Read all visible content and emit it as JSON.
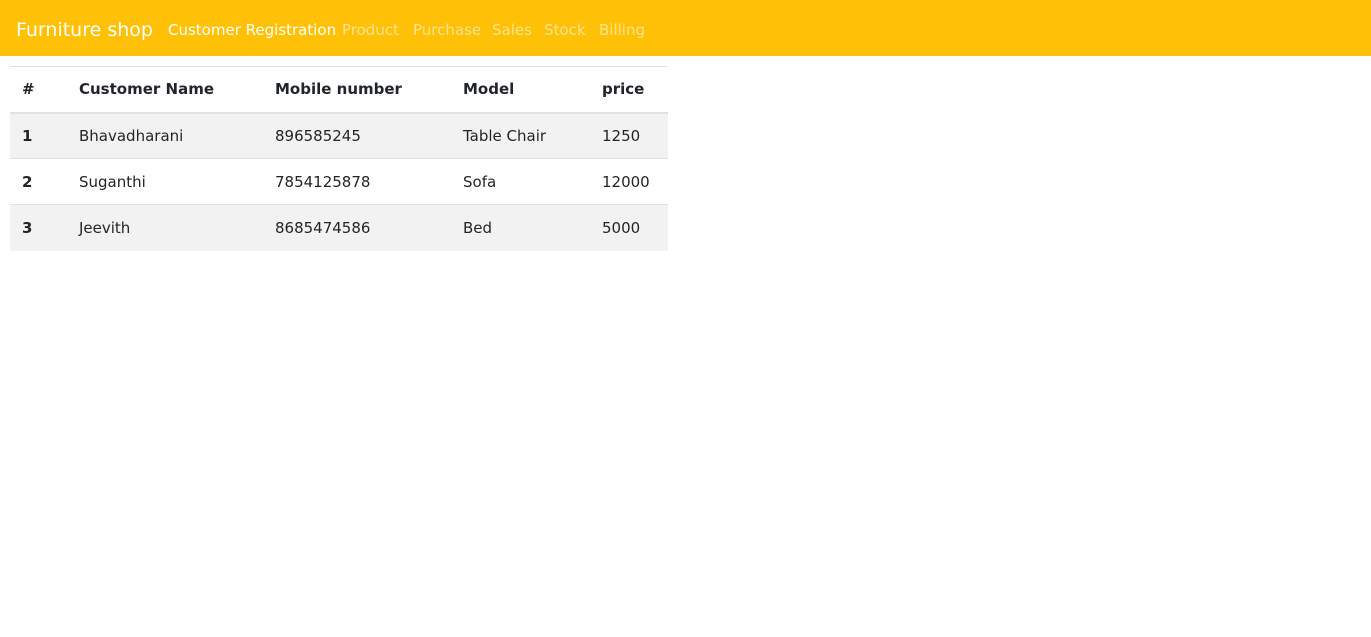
{
  "navbar": {
    "brand": "Furniture shop",
    "links": [
      {
        "label": "Customer Registration",
        "active": true
      },
      {
        "label": "Product",
        "active": false
      },
      {
        "label": "Purchase",
        "active": false
      },
      {
        "label": "Sales",
        "active": false
      },
      {
        "label": "Stock",
        "active": false
      },
      {
        "label": "Billing",
        "active": false
      }
    ],
    "color": "#ffc107"
  },
  "table": {
    "headers": [
      "#",
      "Customer Name",
      "Mobile number",
      "Model",
      "price"
    ],
    "rows": [
      {
        "num": "1",
        "name": "Bhavadharani",
        "mobile": "896585245",
        "model": "Table Chair",
        "price": "1250"
      },
      {
        "num": "2",
        "name": "Suganthi",
        "mobile": "7854125878",
        "model": "Sofa",
        "price": "12000"
      },
      {
        "num": "3",
        "name": "Jeevith",
        "mobile": "8685474586",
        "model": "Bed",
        "price": "5000"
      }
    ]
  }
}
